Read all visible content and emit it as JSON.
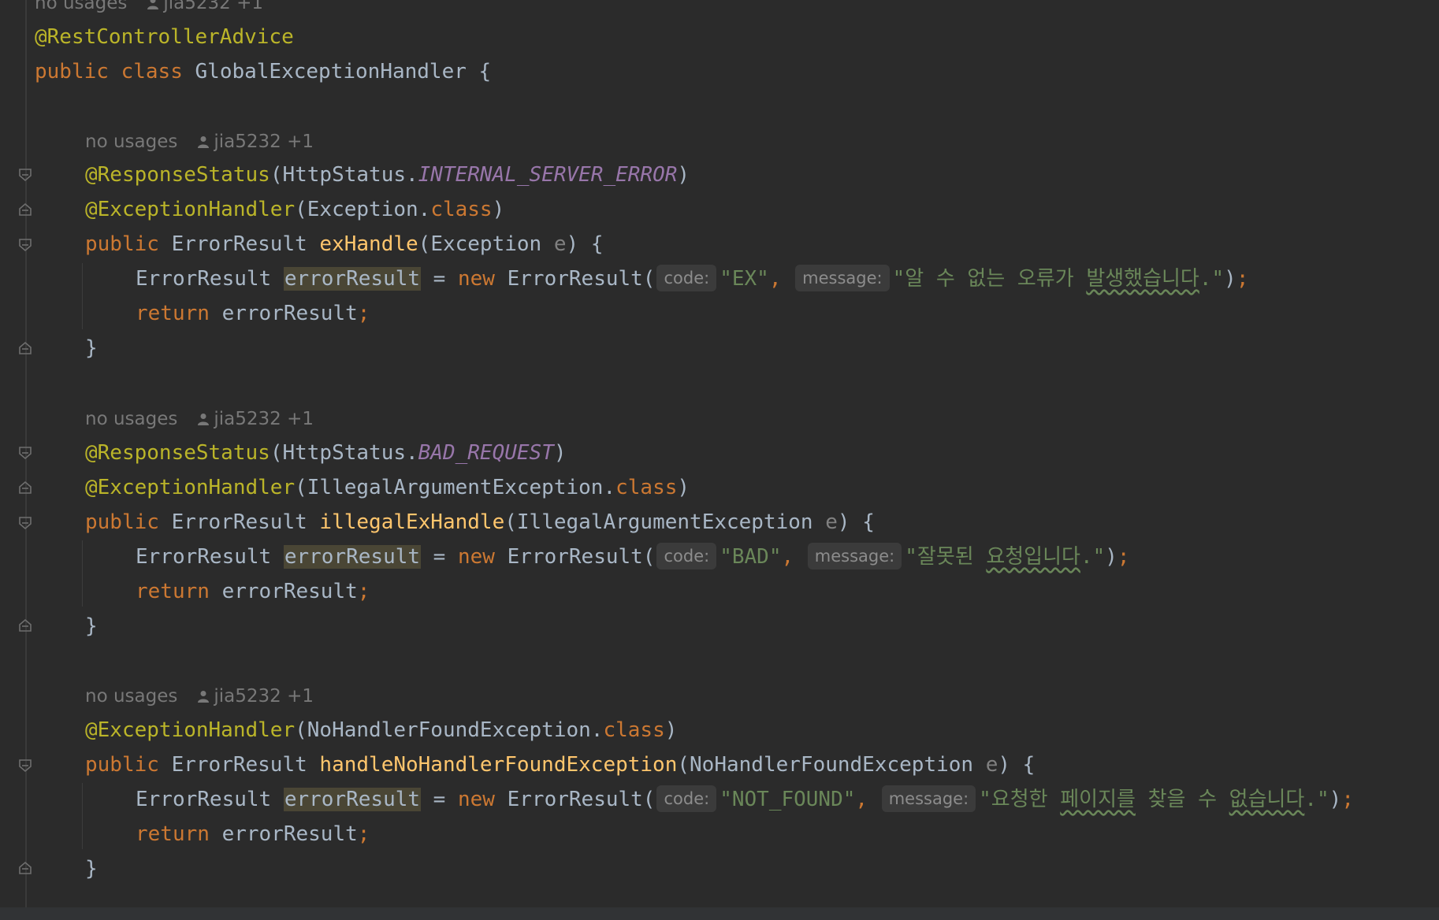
{
  "hints": {
    "usages": "no usages",
    "author": "jia5232 +1"
  },
  "header": {
    "annotation": "@RestControllerAdvice",
    "kw_public": "public",
    "kw_class": "class",
    "class_name": "GlobalExceptionHandler",
    "open_brace": " {"
  },
  "common": {
    "kw_public": "public",
    "kw_new": "new",
    "kw_return": "return",
    "kw_class": "class",
    "type": "ErrorResult",
    "var": "errorResult",
    "assign": " = ",
    "ctor": "ErrorResult(",
    "code_label": "code:",
    "message_label": "message:",
    "semicolon": ";",
    "close_brace": "}",
    "param": "e",
    "response_status": "@ResponseStatus",
    "exception_handler": "@ExceptionHandler",
    "http_status": "HttpStatus."
  },
  "methods": [
    {
      "status_const": "INTERNAL_SERVER_ERROR",
      "exception": "Exception",
      "name": "exHandle",
      "code": "\"EX\"",
      "message_plain": "\"알 수 없는 오류가 ",
      "message_squiggle": "발생했습니다",
      "message_end": ".\""
    },
    {
      "status_const": "BAD_REQUEST",
      "exception": "IllegalArgumentException",
      "name": "illegalExHandle",
      "code": "\"BAD\"",
      "message_plain": "\"잘못된 ",
      "message_squiggle": "요청입니다",
      "message_end": ".\""
    },
    {
      "exception": "NoHandlerFoundException",
      "name": "handleNoHandlerFoundException",
      "code": "\"NOT_FOUND\"",
      "message_plain": "\"요청한 ",
      "message_squiggle": "페이지를",
      "message_mid": " 찾을 수 ",
      "message_squiggle2": "없습니다",
      "message_end": ".\""
    }
  ]
}
